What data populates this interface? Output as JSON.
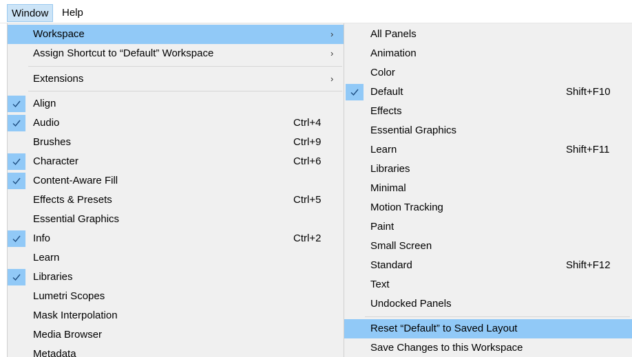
{
  "menubar": {
    "items": [
      {
        "label": "Window"
      },
      {
        "label": "Help"
      }
    ]
  },
  "window_menu": {
    "items": [
      {
        "label": "Workspace",
        "submenu": true,
        "checked": false,
        "shortcut": ""
      },
      {
        "label": "Assign Shortcut to “Default” Workspace",
        "submenu": true,
        "checked": false,
        "shortcut": ""
      },
      {
        "label": "Extensions",
        "submenu": true,
        "checked": false,
        "shortcut": ""
      },
      {
        "label": "Align",
        "checked": true,
        "shortcut": ""
      },
      {
        "label": "Audio",
        "checked": true,
        "shortcut": "Ctrl+4"
      },
      {
        "label": "Brushes",
        "checked": false,
        "shortcut": "Ctrl+9"
      },
      {
        "label": "Character",
        "checked": true,
        "shortcut": "Ctrl+6"
      },
      {
        "label": "Content-Aware Fill",
        "checked": true,
        "shortcut": ""
      },
      {
        "label": "Effects & Presets",
        "checked": false,
        "shortcut": "Ctrl+5"
      },
      {
        "label": "Essential Graphics",
        "checked": false,
        "shortcut": ""
      },
      {
        "label": "Info",
        "checked": true,
        "shortcut": "Ctrl+2"
      },
      {
        "label": "Learn",
        "checked": false,
        "shortcut": ""
      },
      {
        "label": "Libraries",
        "checked": true,
        "shortcut": ""
      },
      {
        "label": "Lumetri Scopes",
        "checked": false,
        "shortcut": ""
      },
      {
        "label": "Mask Interpolation",
        "checked": false,
        "shortcut": ""
      },
      {
        "label": "Media Browser",
        "checked": false,
        "shortcut": ""
      },
      {
        "label": "Metadata",
        "checked": false,
        "shortcut": ""
      }
    ]
  },
  "workspace_submenu": {
    "items": [
      {
        "label": "All Panels",
        "checked": false,
        "shortcut": ""
      },
      {
        "label": "Animation",
        "checked": false,
        "shortcut": ""
      },
      {
        "label": "Color",
        "checked": false,
        "shortcut": ""
      },
      {
        "label": "Default",
        "checked": true,
        "shortcut": "Shift+F10"
      },
      {
        "label": "Effects",
        "checked": false,
        "shortcut": ""
      },
      {
        "label": "Essential Graphics",
        "checked": false,
        "shortcut": ""
      },
      {
        "label": "Learn",
        "checked": false,
        "shortcut": "Shift+F11"
      },
      {
        "label": "Libraries",
        "checked": false,
        "shortcut": ""
      },
      {
        "label": "Minimal",
        "checked": false,
        "shortcut": ""
      },
      {
        "label": "Motion Tracking",
        "checked": false,
        "shortcut": ""
      },
      {
        "label": "Paint",
        "checked": false,
        "shortcut": ""
      },
      {
        "label": "Small Screen",
        "checked": false,
        "shortcut": ""
      },
      {
        "label": "Standard",
        "checked": false,
        "shortcut": "Shift+F12"
      },
      {
        "label": "Text",
        "checked": false,
        "shortcut": ""
      },
      {
        "label": "Undocked Panels",
        "checked": false,
        "shortcut": ""
      },
      {
        "label": "Reset “Default” to Saved Layout",
        "checked": false,
        "shortcut": "",
        "highlighted": true
      },
      {
        "label": "Save Changes to this Workspace",
        "checked": false,
        "shortcut": ""
      }
    ]
  },
  "icons": {
    "submenu_arrow": "chevron-right-icon",
    "check": "checkmark-icon"
  },
  "colors": {
    "menu_bg": "#f0f0f0",
    "highlight": "#91c9f7",
    "menubar_active": "#cce4f7"
  }
}
